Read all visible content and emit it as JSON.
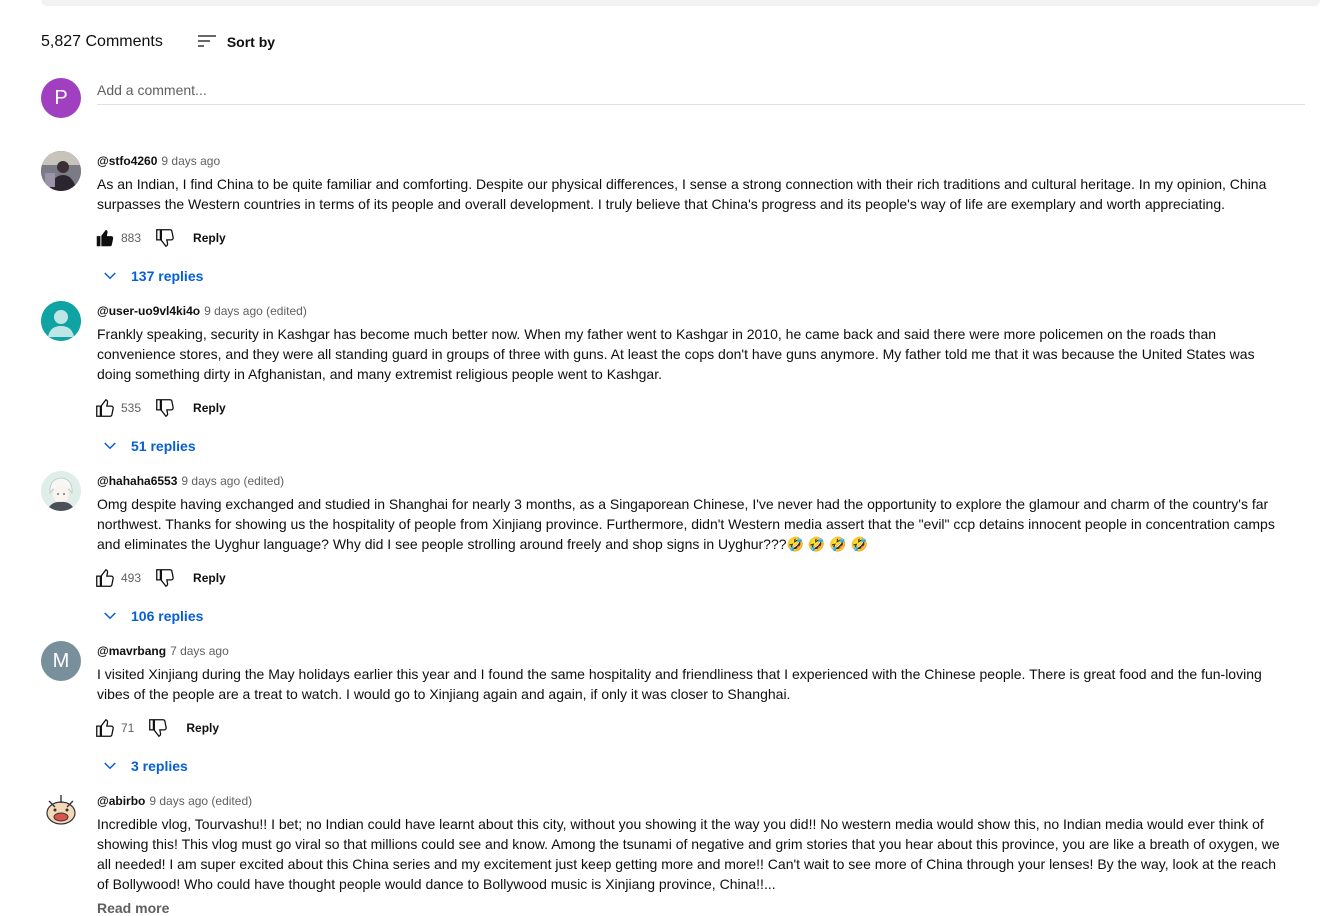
{
  "header": {
    "comment_count": "5,827 Comments",
    "sort_label": "Sort by",
    "sort_icon": "sort-icon"
  },
  "composer": {
    "avatar_letter": "P",
    "avatar_color": "#a13fc1",
    "placeholder": "Add a comment..."
  },
  "colors": {
    "link_blue": "#065fd4",
    "meta_gray": "#606060",
    "text": "#0f0f0f"
  },
  "comments": [
    {
      "author": "@stfo4260",
      "time": "9 days ago",
      "text": "As an Indian, I find China to be quite familiar and comforting. Despite our physical differences, I sense a strong connection with their rich traditions and cultural heritage. In my opinion, China surpasses the Western countries in terms of its people and overall development. I truly believe that China's progress and its people's way of life are exemplary and worth appreciating.",
      "likes": "883",
      "reply_label": "Reply",
      "replies": "137 replies",
      "liked": true
    },
    {
      "author": "@user-uo9vl4ki4o",
      "time": "9 days ago (edited)",
      "text": "Frankly speaking, security in Kashgar has become much better now. When my father went to Kashgar in 2010, he came back and said there were more policemen on the roads than convenience stores, and they were all standing guard in groups of three with guns. At least the cops don't have guns anymore. My father told me that it was because the United States was doing something dirty in Afghanistan, and many extremist religious people went to Kashgar.",
      "likes": "535",
      "reply_label": "Reply",
      "replies": "51 replies",
      "liked": false
    },
    {
      "author": "@hahaha6553",
      "time": "9 days ago (edited)",
      "text": "Omg despite having exchanged and studied in Shanghai for nearly 3 months, as a Singaporean Chinese, I've never had the opportunity to explore the glamour and charm of the country's far northwest. Thanks for showing us the hospitality of people from Xinjiang province. Furthermore, didn't Western media assert that the \"evil\" ccp detains innocent people in concentration camps and eliminates the Uyghur language? Why did I see people strolling around freely and shop signs in Uyghur???🤣 🤣 🤣 🤣",
      "likes": "493",
      "reply_label": "Reply",
      "replies": "106 replies",
      "liked": false
    },
    {
      "author": "@mavrbang",
      "time": "7 days ago",
      "text": "I visited Xinjiang during the May holidays earlier this year and I found the same hospitality and friendliness that I experienced with the Chinese people. There is great food and the fun-loving vibes of the people are a treat to watch. I would go to Xinjiang again and again, if only it was closer to Shanghai.",
      "likes": "71",
      "reply_label": "Reply",
      "replies": "3 replies",
      "liked": false,
      "avatar_letter": "M"
    },
    {
      "author": "@abirbo",
      "time": "9 days ago (edited)",
      "text": "Incredible vlog, Tourvashu!! I bet; no Indian could have learnt about this city, without you showing it the way you did!! No western media would show this, no Indian media would ever think of showing this! This vlog must go viral so that millions could see and know. Among the tsunami of negative and grim stories that you hear about this province, you are like a breath of oxygen, we all needed! I am super excited about this China series and my excitement just keep getting more and more!! Can't wait to see more of China through your lenses! By the way, look at the reach of Bollywood! Who could have thought people would dance to Bollywood music is Xinjiang province, China!!...",
      "read_more": "Read more"
    }
  ]
}
